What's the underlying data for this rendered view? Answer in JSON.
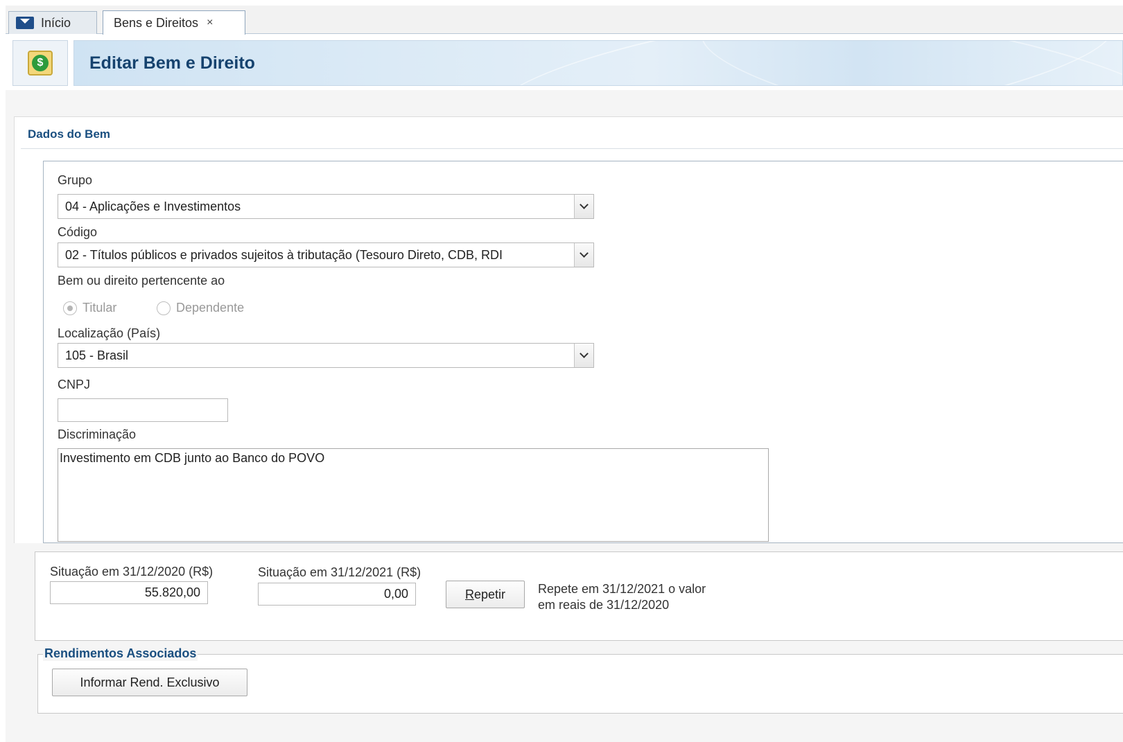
{
  "tabs": [
    {
      "label": "Início"
    },
    {
      "label": "Bens e Direitos",
      "close": "×"
    }
  ],
  "header": {
    "title": "Editar Bem e Direito",
    "icon": "money-icon",
    "icon_glyph": "$"
  },
  "dados": {
    "section_title": "Dados do Bem",
    "grupo": {
      "label": "Grupo",
      "value": "04 - Aplicações e Investimentos"
    },
    "codigo": {
      "label": "Código",
      "value": "02 - Títulos públicos e privados sujeitos à tributação (Tesouro Direto, CDB, RDI"
    },
    "pertence": {
      "label": "Bem ou direito pertencente ao",
      "options": [
        "Titular",
        "Dependente"
      ],
      "selected": "Titular"
    },
    "localizacao": {
      "label": "Localização (País)",
      "value": "105 - Brasil"
    },
    "cnpj": {
      "label": "CNPJ",
      "value": ""
    },
    "discriminacao": {
      "label": "Discriminação",
      "value": "Investimento em CDB junto ao Banco do POVO"
    }
  },
  "situacao": {
    "s2020_label": "Situação em 31/12/2020 (R$)",
    "s2020_value": "55.820,00",
    "s2021_label": "Situação em 31/12/2021 (R$)",
    "s2021_value": "0,00",
    "repetir_mnemonic": "R",
    "repetir_rest": "epetir",
    "hint_line1": "Repete em 31/12/2021 o valor",
    "hint_line2": "em reais de 31/12/2020"
  },
  "rendimentos": {
    "title": "Rendimentos Associados",
    "button": "Informar Rend. Exclusivo"
  },
  "colors": {
    "accent": "#1a4f80",
    "title": "#15426e"
  }
}
